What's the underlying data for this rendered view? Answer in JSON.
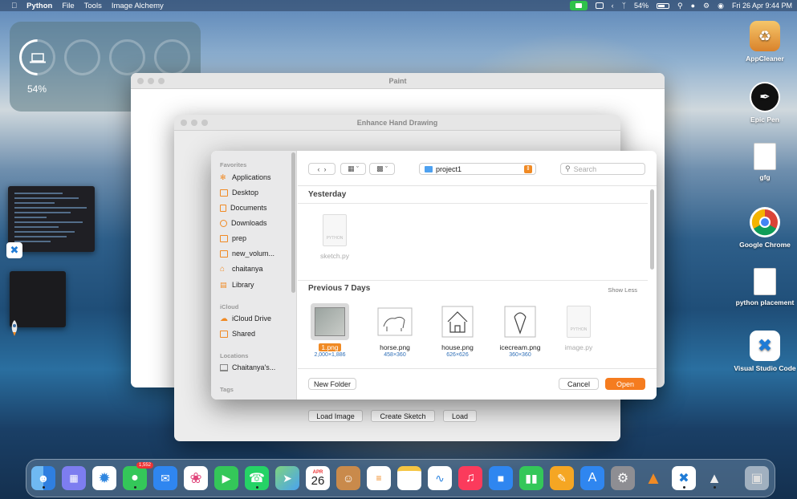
{
  "menubar": {
    "app": "Python",
    "menus": [
      "File",
      "Tools",
      "Image Alchemy"
    ],
    "battery": "54%",
    "datetime": "Fri 26 Apr  9:44 PM"
  },
  "widget": {
    "battery_pct": "54%",
    "battery_level": 0.54
  },
  "desktop_icons": [
    {
      "label": "AppCleaner"
    },
    {
      "label": "Epic Pen"
    },
    {
      "label": "gfg"
    },
    {
      "label": "Google Chrome"
    },
    {
      "label": "python placement"
    },
    {
      "label": "Visual Studio Code"
    }
  ],
  "windows": {
    "paint": {
      "title": "Paint"
    },
    "enhance": {
      "title": "Enhance Hand Drawing",
      "buttons": [
        "Load Image",
        "Create Sketch",
        "Load"
      ]
    }
  },
  "dialog": {
    "sidebar": {
      "favorites_header": "Favorites",
      "favorites": [
        "Applications",
        "Desktop",
        "Documents",
        "Downloads",
        "prep",
        "new_volum...",
        "chaitanya",
        "Library"
      ],
      "icloud_header": "iCloud",
      "icloud": [
        "iCloud Drive",
        "Shared"
      ],
      "locations_header": "Locations",
      "locations": [
        "Chaitanya's..."
      ],
      "tags_header": "Tags"
    },
    "location": "project1",
    "search_placeholder": "Search",
    "sections": {
      "yesterday": "Yesterday",
      "previous": "Previous 7 Days",
      "show_less": "Show Less"
    },
    "yesterday_files": [
      {
        "name": "sketch.py"
      }
    ],
    "previous_files": [
      {
        "name": "1.png",
        "dims": "2,000×1,886"
      },
      {
        "name": "horse.png",
        "dims": "458×360"
      },
      {
        "name": "house.png",
        "dims": "626×626"
      },
      {
        "name": "icecream.png",
        "dims": "360×360"
      },
      {
        "name": "image.py",
        "dims": ""
      }
    ],
    "doc_tag": "PYTHON",
    "buttons": {
      "new_folder": "New Folder",
      "cancel": "Cancel",
      "open": "Open"
    }
  },
  "dock": {
    "calendar_month": "APR",
    "calendar_day": "26",
    "messages_badge": "1,552"
  }
}
